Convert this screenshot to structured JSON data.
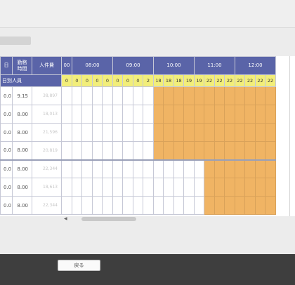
{
  "header": {
    "work_day_col": "日",
    "work_hours_col": "勤務\n時間",
    "labor_cost_col": "人件費",
    "hours": [
      "00",
      "08:00",
      "09:00",
      "10:00",
      "11:00",
      "12:00"
    ],
    "row_label": "日別人員"
  },
  "staff_counts": [
    "0",
    "0",
    "0",
    "0",
    "0",
    "0",
    "0",
    "0",
    "2",
    "18",
    "18",
    "18",
    "19",
    "19",
    "22",
    "22",
    "22",
    "22",
    "22",
    "22",
    "22"
  ],
  "rows": [
    {
      "days": "0.0",
      "hours": "9.15",
      "cost": "38,897",
      "start": 9
    },
    {
      "days": "0.0",
      "hours": "8.00",
      "cost": "18,013",
      "start": 9
    },
    {
      "days": "0.0",
      "hours": "8.00",
      "cost": "21,596",
      "start": 9
    },
    {
      "days": "0.0",
      "hours": "8.00",
      "cost": "20,819",
      "start": 9
    },
    {
      "days": "0.0",
      "hours": "8.00",
      "cost": "22,344",
      "start": 14
    },
    {
      "days": "0.0",
      "hours": "8.00",
      "cost": "18,613",
      "start": 14
    },
    {
      "days": "0.0",
      "hours": "8.00",
      "cost": "22,344",
      "start": 14
    }
  ],
  "colors": {
    "header_bg": "#5a64a8",
    "count_bg": "#f2ee7a",
    "scheduled": "#f0b464"
  },
  "footer": {
    "back_label": "戻る"
  },
  "icons": {
    "scroll_left": "caret-left-icon"
  }
}
